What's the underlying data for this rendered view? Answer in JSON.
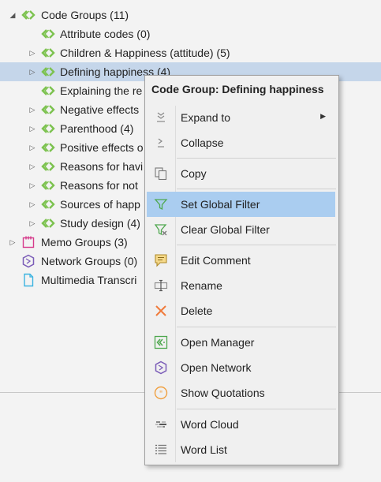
{
  "tree": {
    "code_groups": "Code Groups (11)",
    "items": [
      "Attribute codes (0)",
      "Children & Happiness (attitude) (5)",
      "Defining happiness (4)",
      "Explaining the re",
      "Negative effects",
      "Parenthood (4)",
      "Positive effects o",
      "Reasons for havi",
      "Reasons for not",
      "Sources of happ",
      "Study design (4)"
    ],
    "memo_groups": "Memo Groups (3)",
    "network_groups": "Network Groups (0)",
    "multimedia": "Multimedia Transcri"
  },
  "context_menu": {
    "title": "Code Group: Defining happiness",
    "expand_to": "Expand to",
    "collapse": "Collapse",
    "copy": "Copy",
    "set_global_filter": "Set Global Filter",
    "clear_global_filter": "Clear Global Filter",
    "edit_comment": "Edit Comment",
    "rename": "Rename",
    "delete": "Delete",
    "open_manager": "Open Manager",
    "open_network": "Open Network",
    "show_quotations": "Show Quotations",
    "word_cloud": "Word Cloud",
    "word_list": "Word List"
  },
  "colors": {
    "code_green": "#7cc24f",
    "selection": "#c5d6ea",
    "menu_highlight": "#aacdf0",
    "memo_pink": "#d63c8c",
    "network_purple": "#7b5cb8",
    "doc_cyan": "#3bb3e0",
    "delete_orange": "#f07a3a"
  }
}
